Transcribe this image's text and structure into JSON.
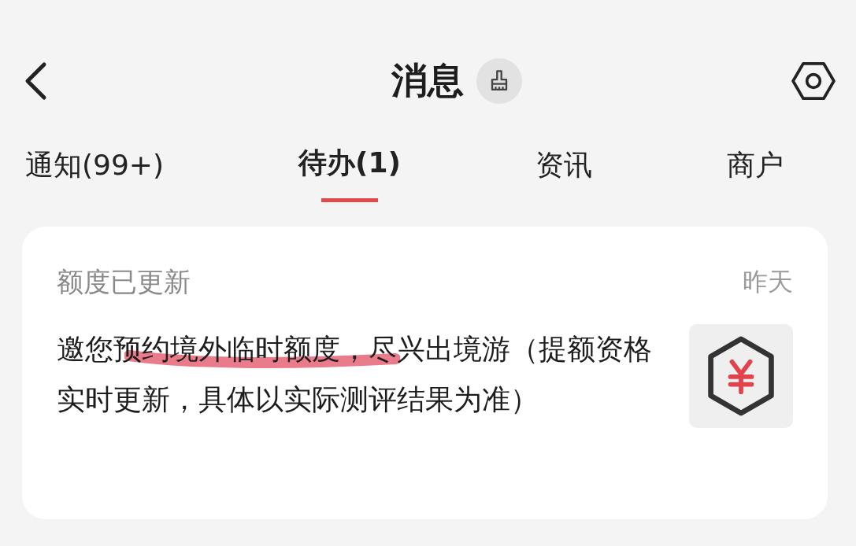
{
  "header": {
    "title": "消息"
  },
  "tabs": [
    {
      "label": "通知(99+)",
      "selected": false
    },
    {
      "label": "待办(1)",
      "selected": true
    },
    {
      "label": "资讯",
      "selected": false
    },
    {
      "label": "商户",
      "selected": false
    }
  ],
  "messages": [
    {
      "title": "额度已更新",
      "time": "昨天",
      "body": "邀您预约境外临时额度，尽兴出境游（提额资格实时更新，具体以实际测评结果为准）",
      "highlighted": true
    }
  ]
}
